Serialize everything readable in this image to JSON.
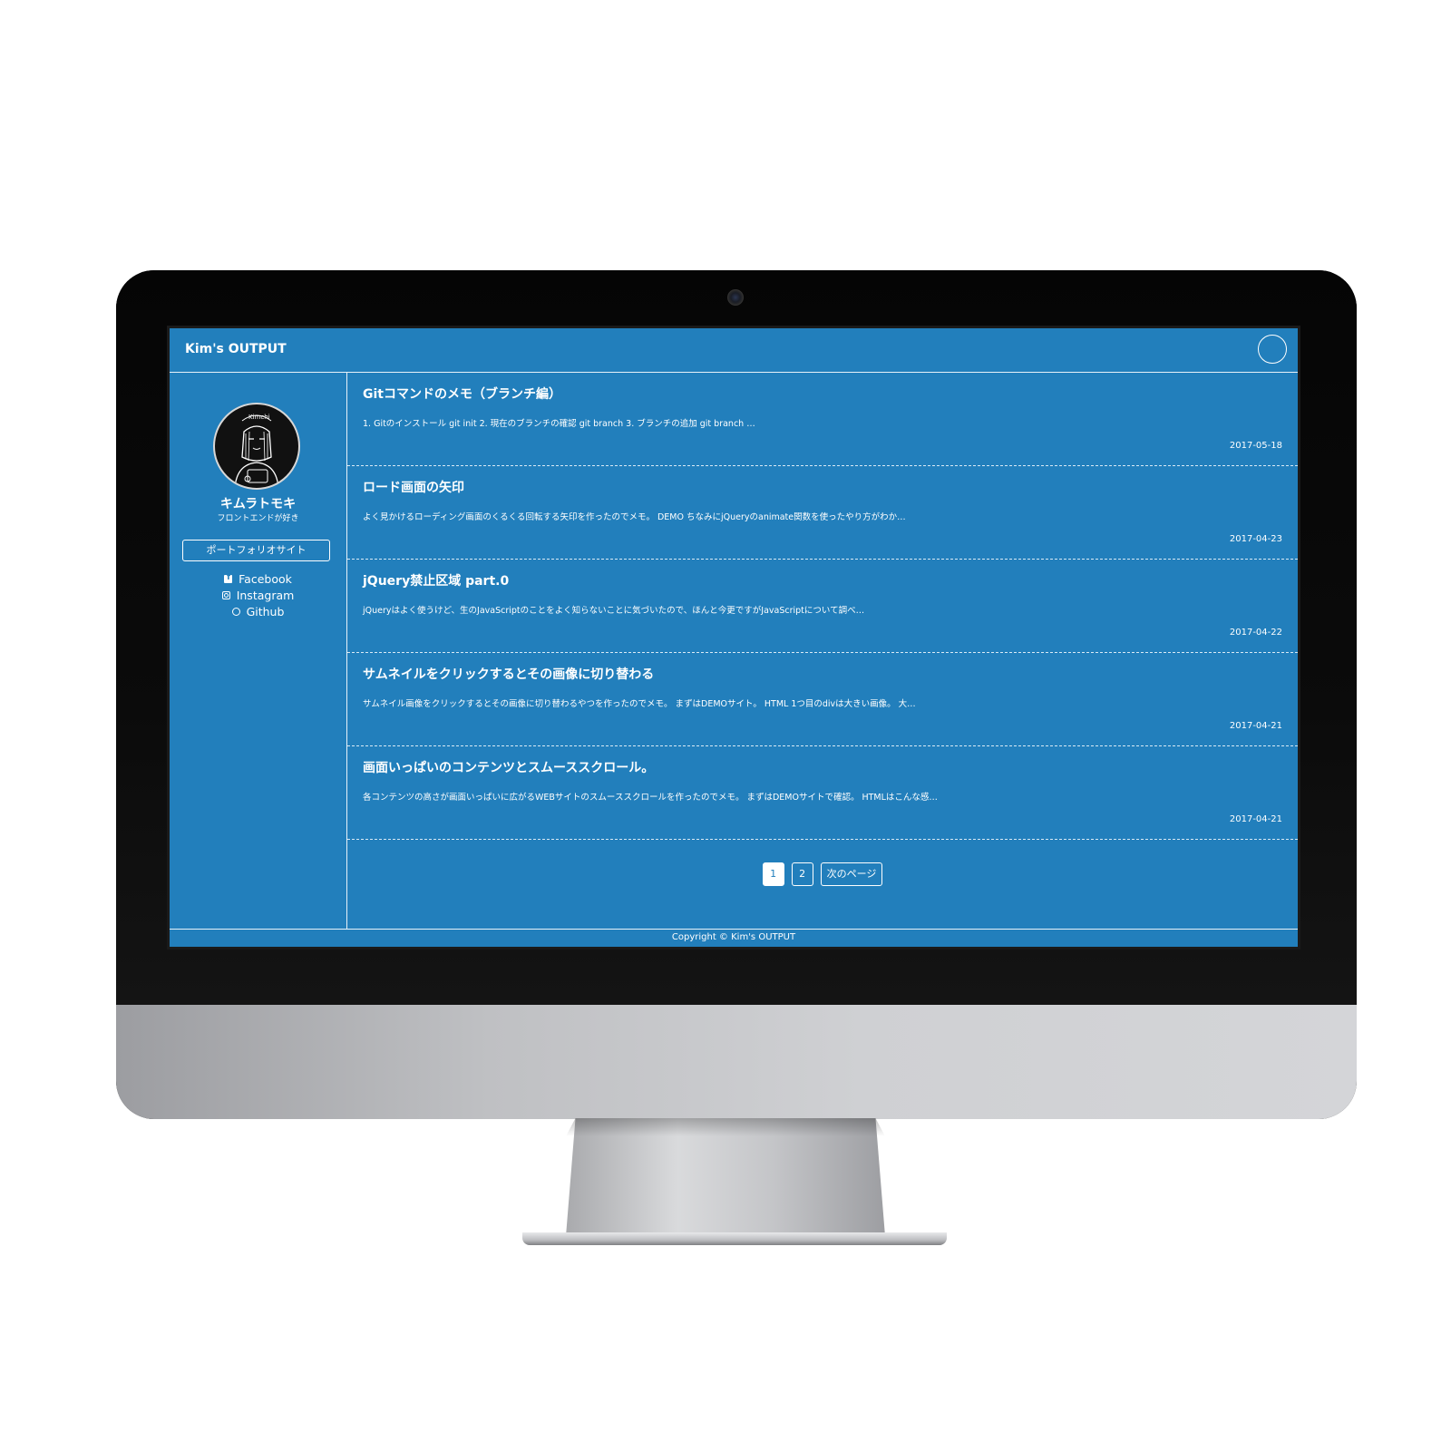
{
  "header": {
    "site_title": "Kim's OUTPUT"
  },
  "profile": {
    "name": "キムラトモキ",
    "tagline": "フロントエンドが好き",
    "portfolio_label": "ポートフォリオサイト",
    "avatar_text": "Kimchi"
  },
  "social": {
    "facebook": "Facebook",
    "instagram": "Instagram",
    "github": "Github"
  },
  "posts": [
    {
      "title": "Gitコマンドのメモ（ブランチ編）",
      "excerpt": "1. Gitのインストール git init 2. 現在のブランチの確認 git branch 3. ブランチの追加 git branch …",
      "date": "2017-05-18"
    },
    {
      "title": "ロード画面の矢印",
      "excerpt": "よく見かけるローディング画面のくるくる回転する矢印を作ったのでメモ。 DEMO ちなみにjQueryのanimate関数を使ったやり方がわか…",
      "date": "2017-04-23"
    },
    {
      "title": "jQuery禁止区域 part.0",
      "excerpt": "jQueryはよく使うけど、生のJavaScriptのことをよく知らないことに気づいたので、ほんと今更ですがJavaScriptについて調べ…",
      "date": "2017-04-22"
    },
    {
      "title": "サムネイルをクリックするとその画像に切り替わる",
      "excerpt": "サムネイル画像をクリックするとその画像に切り替わるやつを作ったのでメモ。 まずはDEMOサイト。 HTML 1つ目のdivは大きい画像。 大…",
      "date": "2017-04-21"
    },
    {
      "title": "画面いっぱいのコンテンツとスムーススクロール。",
      "excerpt": "各コンテンツの高さが画面いっぱいに広がるWEBサイトのスムーススクロールを作ったのでメモ。 まずはDEMOサイトで確認。 HTMLはこんな感…",
      "date": "2017-04-21"
    }
  ],
  "pagination": {
    "page1": "1",
    "page2": "2",
    "next": "次のページ"
  },
  "footer": {
    "copyright": "Copyright © Kim's OUTPUT"
  },
  "colors": {
    "accent": "#227fbc",
    "bezel": "#000000",
    "chin": "#cfd0d3"
  }
}
